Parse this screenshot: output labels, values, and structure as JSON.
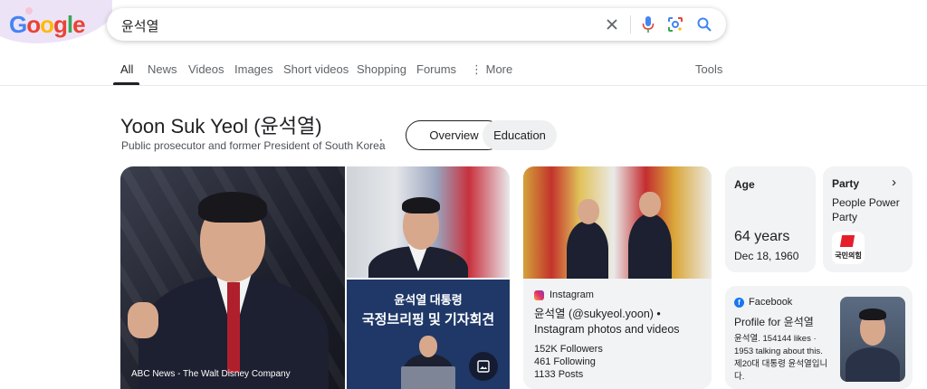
{
  "header": {
    "logo_letters": [
      "G",
      "o",
      "o",
      "g",
      "l",
      "e"
    ],
    "query": "윤석열"
  },
  "tabs": [
    {
      "label": "All",
      "active": true
    },
    {
      "label": "News"
    },
    {
      "label": "Videos"
    },
    {
      "label": "Images"
    },
    {
      "label": "Short videos"
    },
    {
      "label": "Shopping"
    },
    {
      "label": "Forums"
    },
    {
      "label": "More"
    },
    {
      "label": "Tools"
    }
  ],
  "panel": {
    "title": "Yoon Suk Yeol (윤석열)",
    "subtitle": "Public prosecutor and former President of South Korea",
    "chips": [
      "Overview",
      "Education"
    ]
  },
  "images": {
    "main_credit": "ABC News - The Walt Disney Company",
    "briefing_line1": "윤석열 대통령",
    "briefing_line2": "국정브리핑 및 기자회견"
  },
  "instagram": {
    "source": "Instagram",
    "title": "윤석열 (@sukyeol.yoon) • Instagram photos and videos",
    "followers": "152K Followers",
    "following": "461 Following",
    "posts": "1133 Posts"
  },
  "age": {
    "label": "Age",
    "value": "64 years",
    "date": "Dec 18, 1960"
  },
  "party": {
    "label": "Party",
    "value": "People Power Party",
    "logo_text": "국민의힘"
  },
  "facebook": {
    "source": "Facebook",
    "title": "Profile for 윤석열",
    "body": "윤석열. 154144 likes · 1953 talking about this. 제20대 대통령 윤석열입니다."
  },
  "colors": {
    "accent_blue": "#1a73e8",
    "party_red": "#e61e2b",
    "facebook_blue": "#1877f2"
  }
}
